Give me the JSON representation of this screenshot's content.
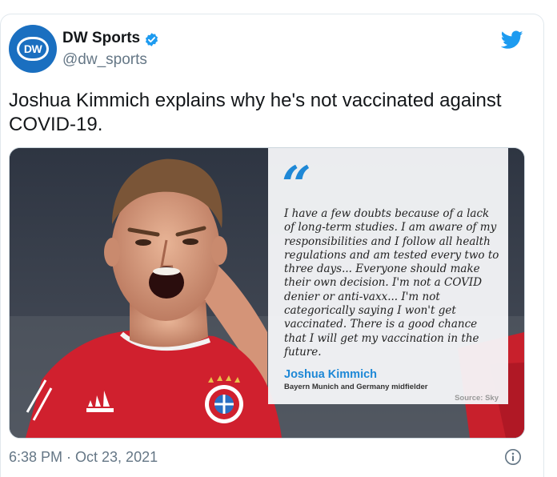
{
  "tweet": {
    "author": {
      "display_name": "DW Sports",
      "handle": "@dw_sports",
      "avatar_text": "DW",
      "verified_icon": "verified-badge-icon"
    },
    "text": "Joshua Kimmich explains why he's not vaccinated against COVID-19.",
    "timestamp": "6:38 PM · Oct 23, 2021",
    "platform_icon": "twitter-bird-icon",
    "info_icon": "info-icon"
  },
  "media": {
    "quote_mark": "“",
    "quote": "I have a few doubts because of a lack of long-term studies. I am aware of my responsibilities and I follow all health regulations and am tested every two to three days... Everyone should make their own decision. I'm not a COVID denier or anti-vaxx... I'm not categorically saying I won't get vaccinated. There is a good chance that I will get my vaccination in the future.",
    "author": "Joshua Kimmich",
    "author_role": "Bayern Munich and Germany midfielder",
    "source": "Source: Sky"
  },
  "colors": {
    "brand_blue": "#1d9bf0",
    "dw_blue": "#1a6fc0",
    "quote_blue": "#1e88d6",
    "jersey_red": "#d0202e",
    "muted_text": "#657786"
  }
}
